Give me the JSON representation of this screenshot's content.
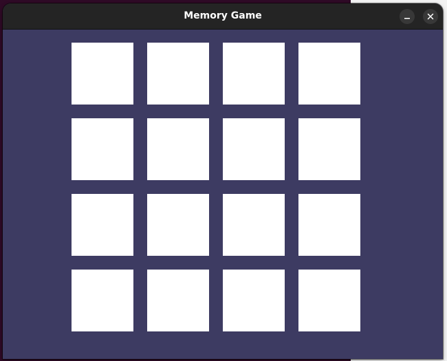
{
  "window": {
    "title": "Memory Game",
    "controls": [
      {
        "name": "minimize",
        "icon": "minimize-icon"
      },
      {
        "name": "close",
        "icon": "close-icon"
      }
    ]
  },
  "colors": {
    "titlebar": "#242424",
    "board_background": "#3d3b62",
    "card_face_down": "#ffffff"
  },
  "board": {
    "rows": 4,
    "columns": 4,
    "cards": [
      {
        "id": 1,
        "state": "face-down"
      },
      {
        "id": 2,
        "state": "face-down"
      },
      {
        "id": 3,
        "state": "face-down"
      },
      {
        "id": 4,
        "state": "face-down"
      },
      {
        "id": 5,
        "state": "face-down"
      },
      {
        "id": 6,
        "state": "face-down"
      },
      {
        "id": 7,
        "state": "face-down"
      },
      {
        "id": 8,
        "state": "face-down"
      },
      {
        "id": 9,
        "state": "face-down"
      },
      {
        "id": 10,
        "state": "face-down"
      },
      {
        "id": 11,
        "state": "face-down"
      },
      {
        "id": 12,
        "state": "face-down"
      },
      {
        "id": 13,
        "state": "face-down"
      },
      {
        "id": 14,
        "state": "face-down"
      },
      {
        "id": 15,
        "state": "face-down"
      },
      {
        "id": 16,
        "state": "face-down"
      }
    ]
  }
}
